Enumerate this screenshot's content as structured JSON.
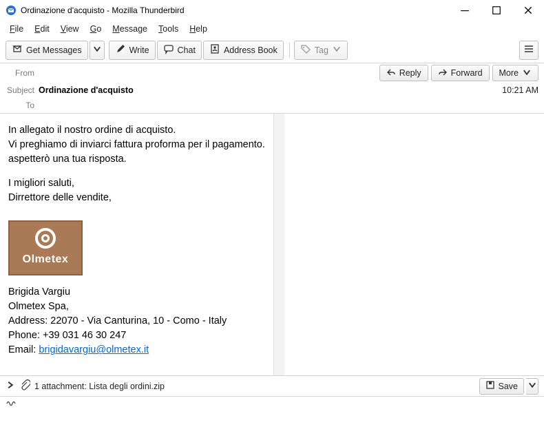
{
  "titlebar": {
    "title": "Ordinazione d'acquisto - Mozilla Thunderbird"
  },
  "menubar": {
    "file": "File",
    "edit": "Edit",
    "view": "View",
    "go": "Go",
    "message": "Message",
    "tools": "Tools",
    "help": "Help"
  },
  "toolbar": {
    "get_messages": "Get Messages",
    "write": "Write",
    "chat": "Chat",
    "address_book": "Address Book",
    "tag": "Tag"
  },
  "header": {
    "from_label": "From",
    "from_value": "",
    "subject_label": "Subject",
    "subject_value": "Ordinazione d'acquisto",
    "to_label": "To",
    "to_value": "",
    "time": "10:21 AM",
    "reply": "Reply",
    "forward": "Forward",
    "more": "More"
  },
  "body": {
    "line1": "In allegato il nostro ordine di acquisto.",
    "line2": "Vi preghiamo di inviarci fattura proforma per il pagamento.",
    "line3": "aspetterò una tua risposta.",
    "signoff1": "I migliori saluti,",
    "signoff2": "Dirrettore delle vendite,",
    "logo_brand": "Olmetex",
    "sig_name": "Brigida Vargiu",
    "sig_company": "Olmetex Spa,",
    "sig_address": "Address: 22070 - Via Canturina, 10 - Como - Italy",
    "sig_phone": "Phone: +39 031 46 30 247",
    "sig_email_prefix": "Email: ",
    "sig_email": "brigidavargiu@olmetex.it"
  },
  "attachment": {
    "label": "1 attachment: Lista degli ordini.zip",
    "save": "Save"
  }
}
